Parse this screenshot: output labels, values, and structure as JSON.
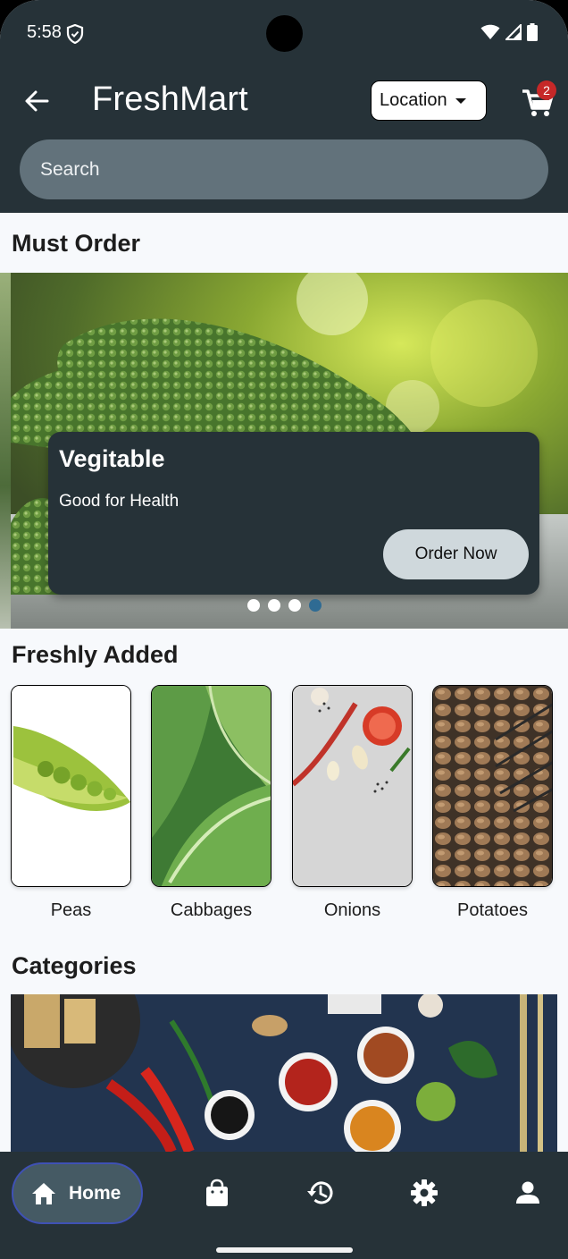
{
  "status_bar": {
    "time": "5:58"
  },
  "app_bar": {
    "title": "FreshMart",
    "location_label": "Location",
    "cart_count": "2"
  },
  "search": {
    "placeholder": "Search"
  },
  "must_order": {
    "title": "Must Order",
    "card": {
      "title": "Vegitable",
      "subtitle": "Good for Health",
      "button_label": "Order Now"
    },
    "carousel": {
      "dot_count": 4,
      "active_index": 3
    }
  },
  "freshly_added": {
    "title": "Freshly Added",
    "items": [
      {
        "name": "Peas"
      },
      {
        "name": "Cabbages"
      },
      {
        "name": "Onions"
      },
      {
        "name": "Potatoes"
      }
    ]
  },
  "categories": {
    "title": "Categories"
  },
  "bottom_nav": {
    "items": [
      {
        "label": "Home",
        "icon": "home-icon",
        "selected": true
      },
      {
        "icon": "shopping-bag-icon"
      },
      {
        "icon": "history-icon"
      },
      {
        "icon": "settings-icon"
      },
      {
        "icon": "person-icon"
      }
    ]
  },
  "colors": {
    "primary_dark": "#263238",
    "search_bg": "#62727b",
    "active_dot": "#2f6b93",
    "badge": "#c62828"
  }
}
